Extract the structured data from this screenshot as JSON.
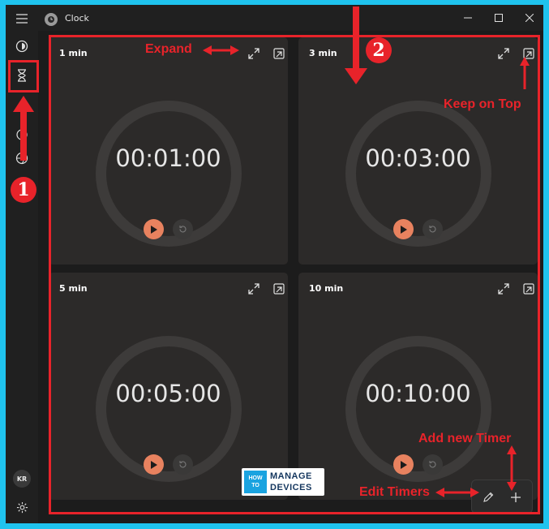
{
  "window": {
    "title": "Clock"
  },
  "sidebar": {
    "menu": "hamburger-icon",
    "items": [
      {
        "icon": "focus-sessions-icon"
      },
      {
        "icon": "hourglass-icon"
      },
      {
        "icon": "stopwatch-icon"
      },
      {
        "icon": "world-clock-icon"
      }
    ],
    "avatar_initials": "KR",
    "settings": "gear-icon"
  },
  "timers": [
    {
      "name": "1 min",
      "time": "00:01:00"
    },
    {
      "name": "3 min",
      "time": "00:03:00"
    },
    {
      "name": "5 min",
      "time": "00:05:00"
    },
    {
      "name": "10 min",
      "time": "00:10:00"
    }
  ],
  "annotations": {
    "expand": "Expand",
    "keep_on_top": "Keep on Top",
    "add_new_timer": "Add new Timer",
    "edit_timers": "Edit Timers",
    "step1": "1",
    "step2": "2"
  },
  "watermark": {
    "how": "HOW",
    "to": "TO",
    "manage": "MANAGE",
    "devices": "DEVICES"
  },
  "colors": {
    "accent": "#e8825f",
    "annotation": "#e8232a",
    "background": "#1fc3ee"
  }
}
